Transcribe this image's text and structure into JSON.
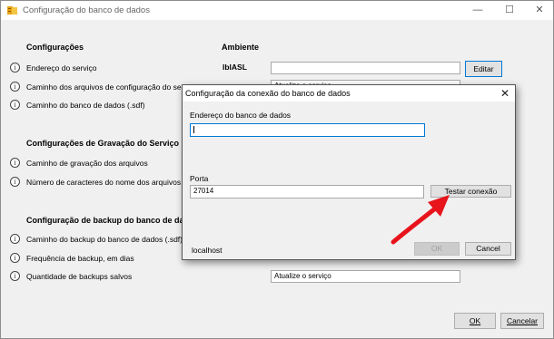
{
  "window": {
    "title": "Configuração do banco de dados",
    "minimize": "—",
    "maximize": "☐",
    "close": "✕"
  },
  "info_glyph": "i",
  "sections": {
    "config": "Configurações",
    "ambiente": "Ambiente",
    "gravacao": "Configurações de Gravação do Serviço",
    "backup": "Configuração de backup do banco de dados"
  },
  "labels": {
    "endereco_servico": "Endereço do serviço",
    "caminho_arquivos_config": "Caminho dos arquivos de configuração do serviço",
    "caminho_banco": "Caminho do banco de dados (.sdf)",
    "caminho_gravacao": "Caminho de gravação dos arquivos",
    "numero_caracteres": "Número de caracteres do nome dos arquivos gerados",
    "caminho_backup": "Caminho do backup do banco de dados (.sdf)",
    "frequencia_backup": "Frequência de backup, em dias",
    "quantidade_backups": "Quantidade de backups salvos",
    "ambiente_value": "IblASL"
  },
  "fields": {
    "ambiente_field": "",
    "caminho_config_field": "Atualize o serviço",
    "quantidade_field": "Atualize o serviço"
  },
  "buttons": {
    "editar": "Editar",
    "ok": "OK",
    "cancelar": "Cancelar"
  },
  "modal": {
    "title": "Configuração da conexão do banco de dados",
    "close": "✕",
    "endereco_label": "Endereço do banco de dados",
    "endereco_value": "",
    "porta_label": "Porta",
    "porta_value": "27014",
    "testar_button": "Testar conexão",
    "status_text": "localhost",
    "ok_button": "OK",
    "cancel_button": "Cancel"
  }
}
